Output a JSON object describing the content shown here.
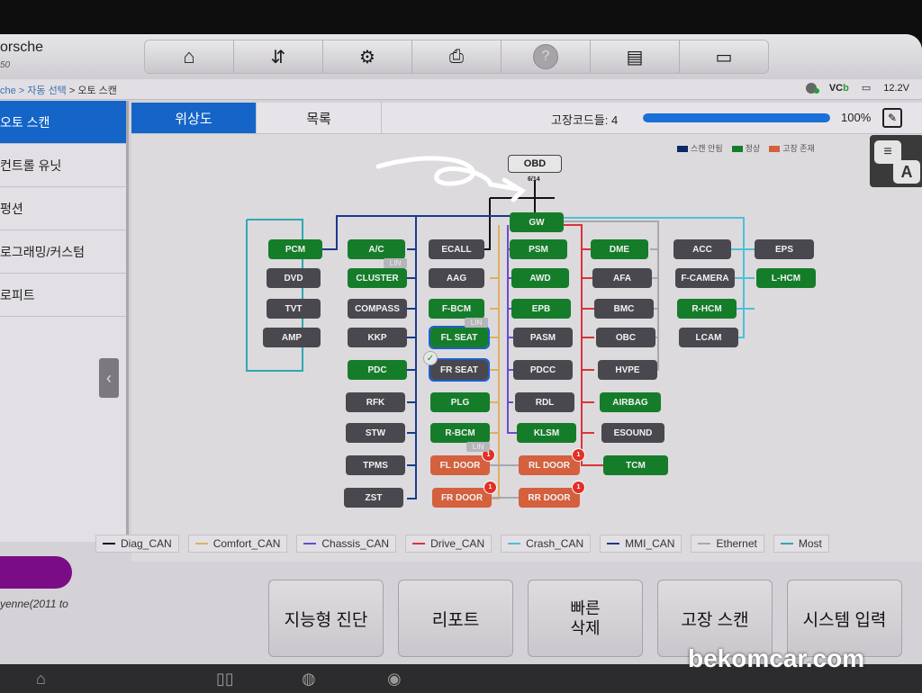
{
  "header": {
    "make": "orsche",
    "sub": "50"
  },
  "toolbar": [
    {
      "name": "home-icon",
      "glyph": "⌂"
    },
    {
      "name": "vehicle-swap-icon",
      "glyph": "⇆"
    },
    {
      "name": "settings-icon",
      "glyph": "⚙"
    },
    {
      "name": "print-icon",
      "glyph": "⎙"
    },
    {
      "name": "help-icon",
      "glyph": "?"
    },
    {
      "name": "save-icon",
      "glyph": "▤"
    },
    {
      "name": "message-icon",
      "glyph": "💬"
    }
  ],
  "breadcrumb": {
    "part1": "che > 자동 선택",
    "sep": " > ",
    "current": "오토 스캔"
  },
  "status": {
    "vci": "VC",
    "vci_suffix": "b",
    "voltage": "12.2V"
  },
  "sidebar": {
    "items": [
      {
        "label": "오토 스캔",
        "active": true
      },
      {
        "label": "컨트롤 유닛"
      },
      {
        "label": "펑션"
      },
      {
        "label": "로그래밍/커스텀"
      },
      {
        "label": "로피트"
      }
    ]
  },
  "tabs": [
    {
      "label": "위상도",
      "active": true
    },
    {
      "label": "목록"
    }
  ],
  "scan": {
    "fault_label": "고장코드들: 4",
    "fault_count": 4,
    "progress_percent": 100,
    "progress_label": "100%"
  },
  "legend_status": [
    {
      "label": "스캔 안됨",
      "color": "#0c2a66"
    },
    {
      "label": "정상",
      "color": "#157d2a"
    },
    {
      "label": "고장 존재",
      "color": "#d4603e"
    }
  ],
  "obd": {
    "label": "OBD",
    "port": "6/14"
  },
  "nodes": {
    "GW": {
      "label": "GW",
      "status": "ok"
    },
    "PCM": {
      "label": "PCM",
      "status": "ok"
    },
    "DVD": {
      "label": "DVD",
      "status": "ns"
    },
    "TVT": {
      "label": "TVT",
      "status": "ns"
    },
    "AMP": {
      "label": "AMP",
      "status": "ns"
    },
    "AC": {
      "label": "A/C",
      "status": "ok"
    },
    "CLUSTER": {
      "label": "CLUSTER",
      "status": "ok"
    },
    "COMPASS": {
      "label": "COMPASS",
      "status": "ns"
    },
    "KKP": {
      "label": "KKP",
      "status": "ns"
    },
    "PDC": {
      "label": "PDC",
      "status": "ok"
    },
    "RFK": {
      "label": "RFK",
      "status": "ns"
    },
    "STW": {
      "label": "STW",
      "status": "ns"
    },
    "TPMS": {
      "label": "TPMS",
      "status": "ns"
    },
    "ZST": {
      "label": "ZST",
      "status": "ns"
    },
    "ECALL": {
      "label": "ECALL",
      "status": "ns"
    },
    "AAG": {
      "label": "AAG",
      "status": "ns"
    },
    "FBCM": {
      "label": "F-BCM",
      "status": "ok"
    },
    "FLSEAT": {
      "label": "FL SEAT",
      "status": "ok"
    },
    "FRSEAT": {
      "label": "FR SEAT",
      "status": "ns"
    },
    "PLG": {
      "label": "PLG",
      "status": "ok"
    },
    "RBCM": {
      "label": "R-BCM",
      "status": "ok"
    },
    "FLDOOR": {
      "label": "FL DOOR",
      "status": "fault",
      "dtc": "1"
    },
    "FRDOOR": {
      "label": "FR DOOR",
      "status": "fault",
      "dtc": "1"
    },
    "PSM": {
      "label": "PSM",
      "status": "ok"
    },
    "AWD": {
      "label": "AWD",
      "status": "ok"
    },
    "EPB": {
      "label": "EPB",
      "status": "ok"
    },
    "PASM": {
      "label": "PASM",
      "status": "ns"
    },
    "PDCC": {
      "label": "PDCC",
      "status": "ns"
    },
    "RDL": {
      "label": "RDL",
      "status": "ns"
    },
    "KLSM": {
      "label": "KLSM",
      "status": "ok"
    },
    "RLDOOR": {
      "label": "RL DOOR",
      "status": "fault",
      "dtc": "1"
    },
    "RRDOOR": {
      "label": "RR DOOR",
      "status": "fault",
      "dtc": "1"
    },
    "DME": {
      "label": "DME",
      "status": "ok"
    },
    "AFA": {
      "label": "AFA",
      "status": "ns"
    },
    "BMC": {
      "label": "BMC",
      "status": "ns"
    },
    "OBC": {
      "label": "OBC",
      "status": "ns"
    },
    "HVPE": {
      "label": "HVPE",
      "status": "ns"
    },
    "AIRBAG": {
      "label": "AIRBAG",
      "status": "ok"
    },
    "ESOUND": {
      "label": "ESOUND",
      "status": "ns"
    },
    "TCM": {
      "label": "TCM",
      "status": "ok"
    },
    "ACC": {
      "label": "ACC",
      "status": "ns"
    },
    "FCAMERA": {
      "label": "F-CAMERA",
      "status": "ns"
    },
    "RHCM": {
      "label": "R-HCM",
      "status": "ok"
    },
    "LCAM": {
      "label": "LCAM",
      "status": "ns"
    },
    "EPS": {
      "label": "EPS",
      "status": "ns"
    },
    "LHCM": {
      "label": "L-HCM",
      "status": "ok"
    }
  },
  "lin_label": "LIN",
  "bus_legend": [
    {
      "label": "Diag_CAN",
      "color": "#111111"
    },
    {
      "label": "Comfort_CAN",
      "color": "#e0b060"
    },
    {
      "label": "Chassis_CAN",
      "color": "#6a4ad0"
    },
    {
      "label": "Drive_CAN",
      "color": "#d8343a"
    },
    {
      "label": "Crash_CAN",
      "color": "#4cc0d8"
    },
    {
      "label": "MMI_CAN",
      "color": "#1a3a8a"
    },
    {
      "label": "Ethernet",
      "color": "#a8a8ac"
    },
    {
      "label": "Most",
      "color": "#30a8b0"
    }
  ],
  "vehicle": {
    "model": "yenne(2011 to"
  },
  "actions": [
    {
      "label": "지능형 진단"
    },
    {
      "label": "리포트"
    },
    {
      "label": "빠른\n삭제"
    },
    {
      "label": "고장 스캔"
    },
    {
      "label": "시스템 입력"
    }
  ],
  "watermark": "bekomcar.com",
  "overlay": {
    "a_label": "A"
  }
}
